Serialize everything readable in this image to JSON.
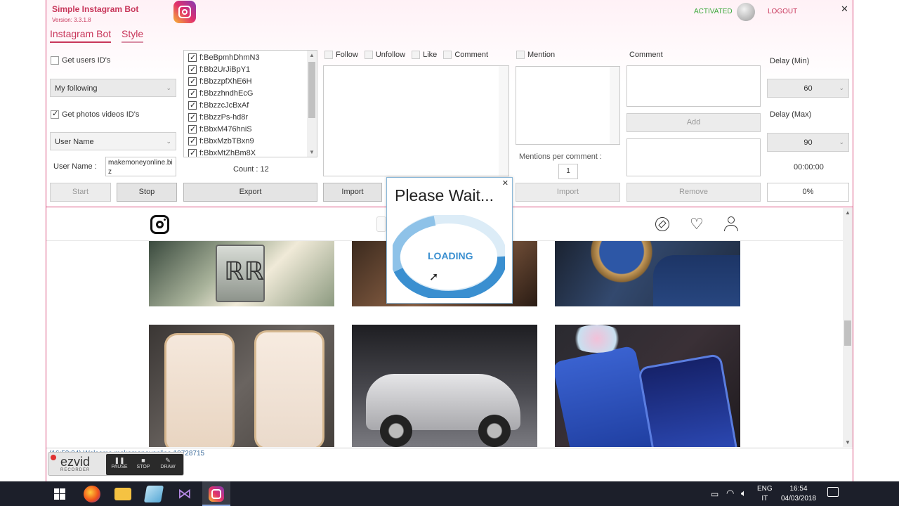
{
  "app": {
    "title": "Simple Instagram Bot",
    "version": "Version: 3.3.1.8",
    "status": "ACTIVATED",
    "logout": "LOGOUT",
    "close": "✕"
  },
  "tabs": [
    {
      "label": "Instagram Bot"
    },
    {
      "label": "Style"
    }
  ],
  "left": {
    "get_users_ids": "Get users ID's",
    "get_users_checked": false,
    "source_select": "My following",
    "get_photos_videos": "Get photos videos ID's",
    "get_photos_checked": true,
    "mode_select": "User Name",
    "username_label": "User Name :",
    "username_value": "makemoneyonline.biz",
    "start": "Start",
    "stop": "Stop"
  },
  "idlist": {
    "items": [
      "f:BeBpmhDhmN3",
      "f:Bb2UrJiBpY1",
      "f:BbzzpfXhE6H",
      "f:BbzzhndhEcG",
      "f:BbzzcJcBxAf",
      "f:BbzzPs-hd8r",
      "f:BbxM476hniS",
      "f:BbxMzbTBxn9",
      "f:BbxMtZhBm8X"
    ],
    "count": "Count : 12",
    "export": "Export"
  },
  "actions": {
    "follow": "Follow",
    "unfollow": "Unfollow",
    "like": "Like",
    "comment": "Comment",
    "import": "Import"
  },
  "mention": {
    "label": "Mention",
    "per_comment_label": "Mentions per comment :",
    "per_comment_value": "1",
    "import": "Import"
  },
  "comment": {
    "label": "Comment",
    "add": "Add",
    "remove": "Remove"
  },
  "delay": {
    "min_label": "Delay (Min)",
    "min_value": "60",
    "max_label": "Delay (Max)",
    "max_value": "90",
    "timer": "00:00:00",
    "progress": "0%"
  },
  "dialog": {
    "title": "Please Wait...",
    "loading": "LOADING",
    "close": "✕"
  },
  "log": {
    "text": "(16:53:34) Welcome makemoneyonline 10728715"
  },
  "recorder": {
    "brand": "ezvid",
    "sub": "RECORDER",
    "pause": "PAUSE",
    "stop": "STOP",
    "draw": "DRAW"
  },
  "taskbar": {
    "lang": "ENG",
    "region": "IT",
    "time": "16:54",
    "date": "04/03/2018"
  },
  "colors": {
    "accent": "#c8365a",
    "activated": "#3aa83a",
    "loading": "#3a8fd0",
    "taskbar": "#1c1f2a"
  }
}
